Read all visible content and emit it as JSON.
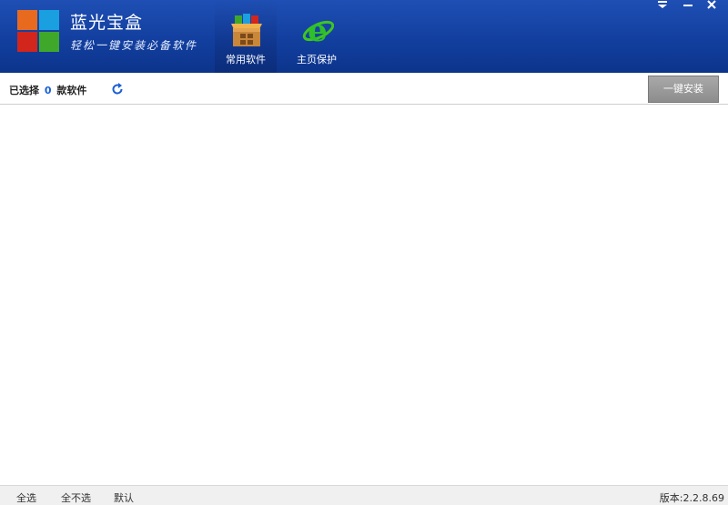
{
  "header": {
    "title": "蓝光宝盒",
    "subtitle": "轻松一键安装必备软件",
    "tabs": [
      {
        "label": "常用软件",
        "icon": "software-box-icon",
        "active": true
      },
      {
        "label": "主页保护",
        "icon": "ie-browser-icon",
        "active": false
      }
    ],
    "window_controls": {
      "menu": "▼",
      "minimize": "—",
      "close": "✕"
    }
  },
  "toolbar": {
    "selected_prefix": "已选择",
    "selected_count": "0",
    "selected_suffix": "款软件",
    "install_label": "一键安装"
  },
  "footer": {
    "select_all": "全选",
    "select_none": "全不选",
    "default": "默认",
    "version": "版本:2.2.8.69"
  },
  "colors": {
    "header_blue": "#123f9f",
    "count_blue": "#1a5fd6",
    "install_button_gray": "#9a9a9a"
  }
}
